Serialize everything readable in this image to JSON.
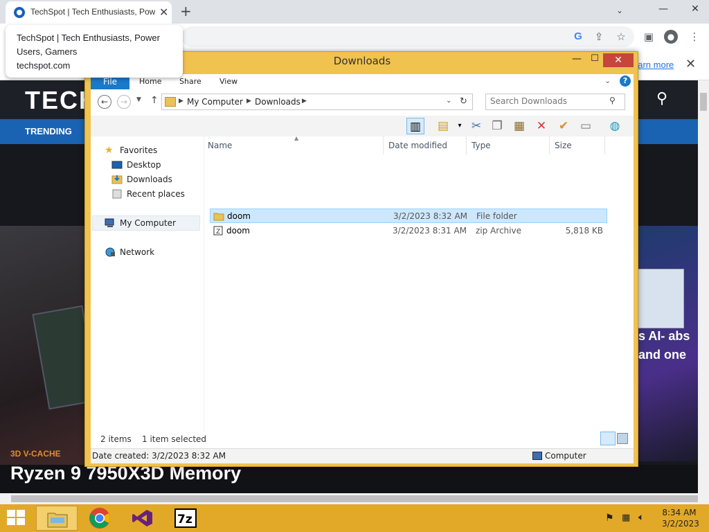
{
  "browser": {
    "tab_title": "TechSpot | Tech Enthusiasts, Power",
    "tooltip_title": "TechSpot | Tech Enthusiasts, Power Users, Gamers",
    "tooltip_url": "techspot.com",
    "banner_link": "earn more"
  },
  "site": {
    "logo": "TECH",
    "nav_trending": "TRENDING",
    "story_tag": "3D V-CACHE",
    "story_headline": "Ryzen 9 7950X3D Memory",
    "side_story": "s AI- abs and one"
  },
  "explorer": {
    "title": "Downloads",
    "ribbon_tabs": [
      "File",
      "Home",
      "Share",
      "View"
    ],
    "breadcrumb": [
      "My Computer",
      "Downloads"
    ],
    "search_placeholder": "Search Downloads",
    "nav": {
      "favorites": "Favorites",
      "desktop": "Desktop",
      "downloads": "Downloads",
      "recent": "Recent places",
      "mycomputer": "My Computer",
      "network": "Network"
    },
    "columns": [
      "Name",
      "Date modified",
      "Type",
      "Size"
    ],
    "files": [
      {
        "name": "doom",
        "date": "3/2/2023 8:32 AM",
        "type": "File folder",
        "size": ""
      },
      {
        "name": "doom",
        "date": "3/2/2023 8:31 AM",
        "type": "zip Archive",
        "size": "5,818 KB"
      }
    ],
    "status_items": "2 items",
    "status_selected": "1 item selected",
    "details_date": "Date created: 3/2/2023 8:32 AM",
    "details_location": "Computer"
  },
  "taskbar": {
    "time": "8:34 AM",
    "date": "3/2/2023"
  },
  "colors": {
    "window_frame": "#f0c24e",
    "taskbar": "#e2a928",
    "accent": "#1979ca",
    "selection": "#cce8ff"
  }
}
